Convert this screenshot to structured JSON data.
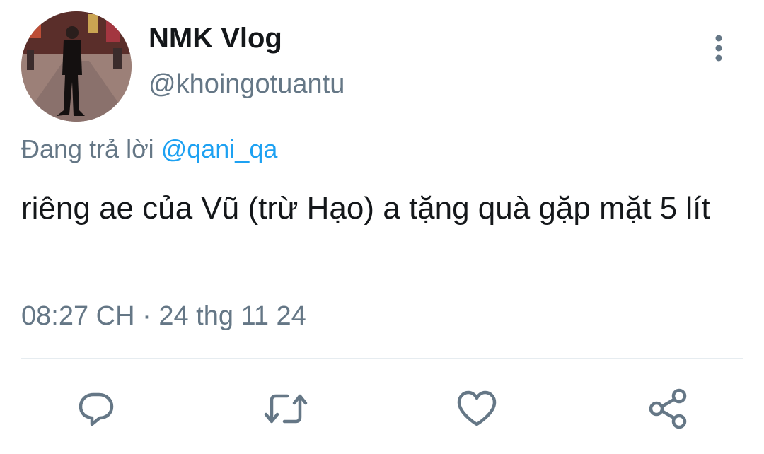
{
  "tweet": {
    "display_name": "NMK Vlog",
    "handle": "@khoingotuantu",
    "reply_prefix": "Đang trả lời",
    "reply_mention": "@qani_qa",
    "text": "riêng ae của Vũ (trừ Hạo) a tặng quà gặp mặt 5 lít",
    "time": "08:27 CH",
    "separator": "·",
    "date": "24 thg 11 24"
  },
  "icons": {
    "more": "more-vertical-icon",
    "reply": "reply-icon",
    "retweet": "retweet-icon",
    "like": "heart-icon",
    "share": "share-icon"
  },
  "colors": {
    "text": "#14171a",
    "secondary": "#657786",
    "link": "#1da1f2",
    "icon": "#657786"
  }
}
